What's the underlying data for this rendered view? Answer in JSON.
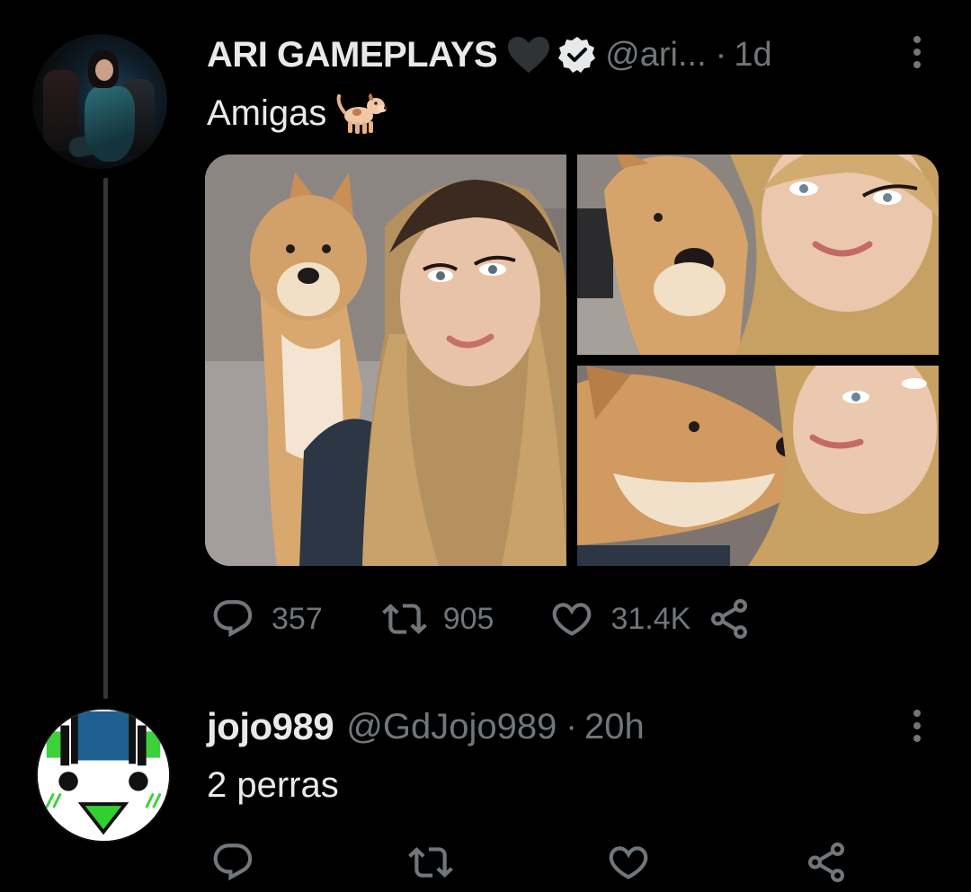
{
  "tweet1": {
    "display_name": "ARI GAMEPLAYS",
    "name_emoji_icon": "black-heart-icon",
    "verified_icon": "verified-badge-icon",
    "handle": "@ari...",
    "separator": "·",
    "time": "1d",
    "text": "Amigas",
    "text_emoji_icon": "dog-emoji-icon",
    "media_count": 3,
    "reply_count": "357",
    "retweet_count": "905",
    "like_count": "31.4K"
  },
  "tweet2": {
    "display_name": "jojo989",
    "handle": "@GdJojo989",
    "separator": "·",
    "time": "20h",
    "text": "2 perras",
    "reply_count": "",
    "retweet_count": "",
    "like_count": ""
  },
  "colors": {
    "background": "#000000",
    "primary_text": "#e7e9ea",
    "secondary_text": "#71767b",
    "thread_line": "#333639"
  }
}
